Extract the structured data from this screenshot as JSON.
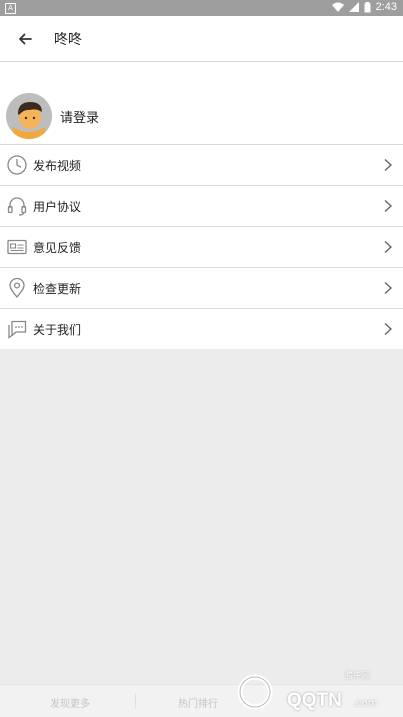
{
  "status_bar": {
    "notification_icon": "A",
    "time": "2:43"
  },
  "app_bar": {
    "title": "咚咚"
  },
  "profile": {
    "login_text": "请登录"
  },
  "menu": [
    {
      "label": "发布视频",
      "icon": "clock-icon"
    },
    {
      "label": "用户协议",
      "icon": "headset-icon"
    },
    {
      "label": "意见反馈",
      "icon": "card-icon"
    },
    {
      "label": "检查更新",
      "icon": "location-pin-icon"
    },
    {
      "label": "关于我们",
      "icon": "chat-icon"
    }
  ],
  "bottom_nav": {
    "tab1": "发现更多",
    "tab2": "热门排行"
  },
  "watermark": {
    "brand": "QQTN",
    "small": "腾牛网",
    "domain": ".com"
  }
}
